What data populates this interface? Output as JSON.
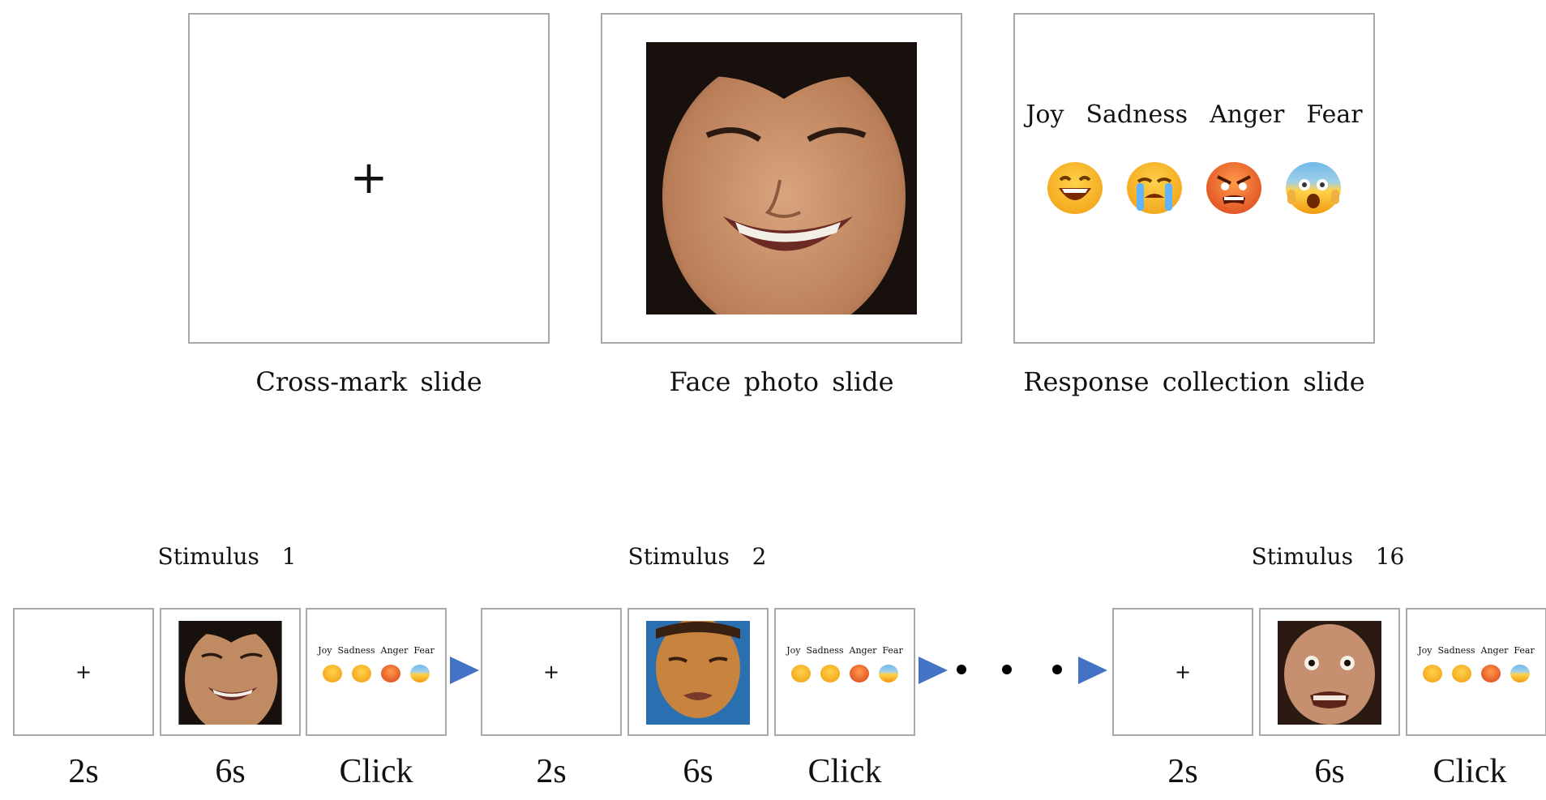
{
  "top_slides": [
    {
      "caption": "Cross-mark slide",
      "content": "+"
    },
    {
      "caption": "Face photo slide",
      "image": "smiling child face photo"
    },
    {
      "caption": "Response collection slide",
      "emotions": [
        "Joy",
        "Sadness",
        "Anger",
        "Fear"
      ]
    }
  ],
  "emotion_labels_line": "Joy  Sadness  Anger  Fear",
  "cross_symbol": "+",
  "emoji_icons": [
    "grinning-face-icon",
    "crying-face-icon",
    "angry-face-icon",
    "fearful-face-icon"
  ],
  "sequence": [
    {
      "stimulus_label": "Stimulus  1",
      "timings": [
        "2s",
        "6s",
        "Click"
      ]
    },
    {
      "stimulus_label": "Stimulus  2",
      "timings": [
        "2s",
        "6s",
        "Click"
      ]
    },
    {
      "stimulus_label": "Stimulus  16",
      "timings": [
        "2s",
        "6s",
        "Click"
      ]
    }
  ],
  "colors": {
    "arrow": "#4472c4",
    "slide_border": "#a8a8a8"
  }
}
